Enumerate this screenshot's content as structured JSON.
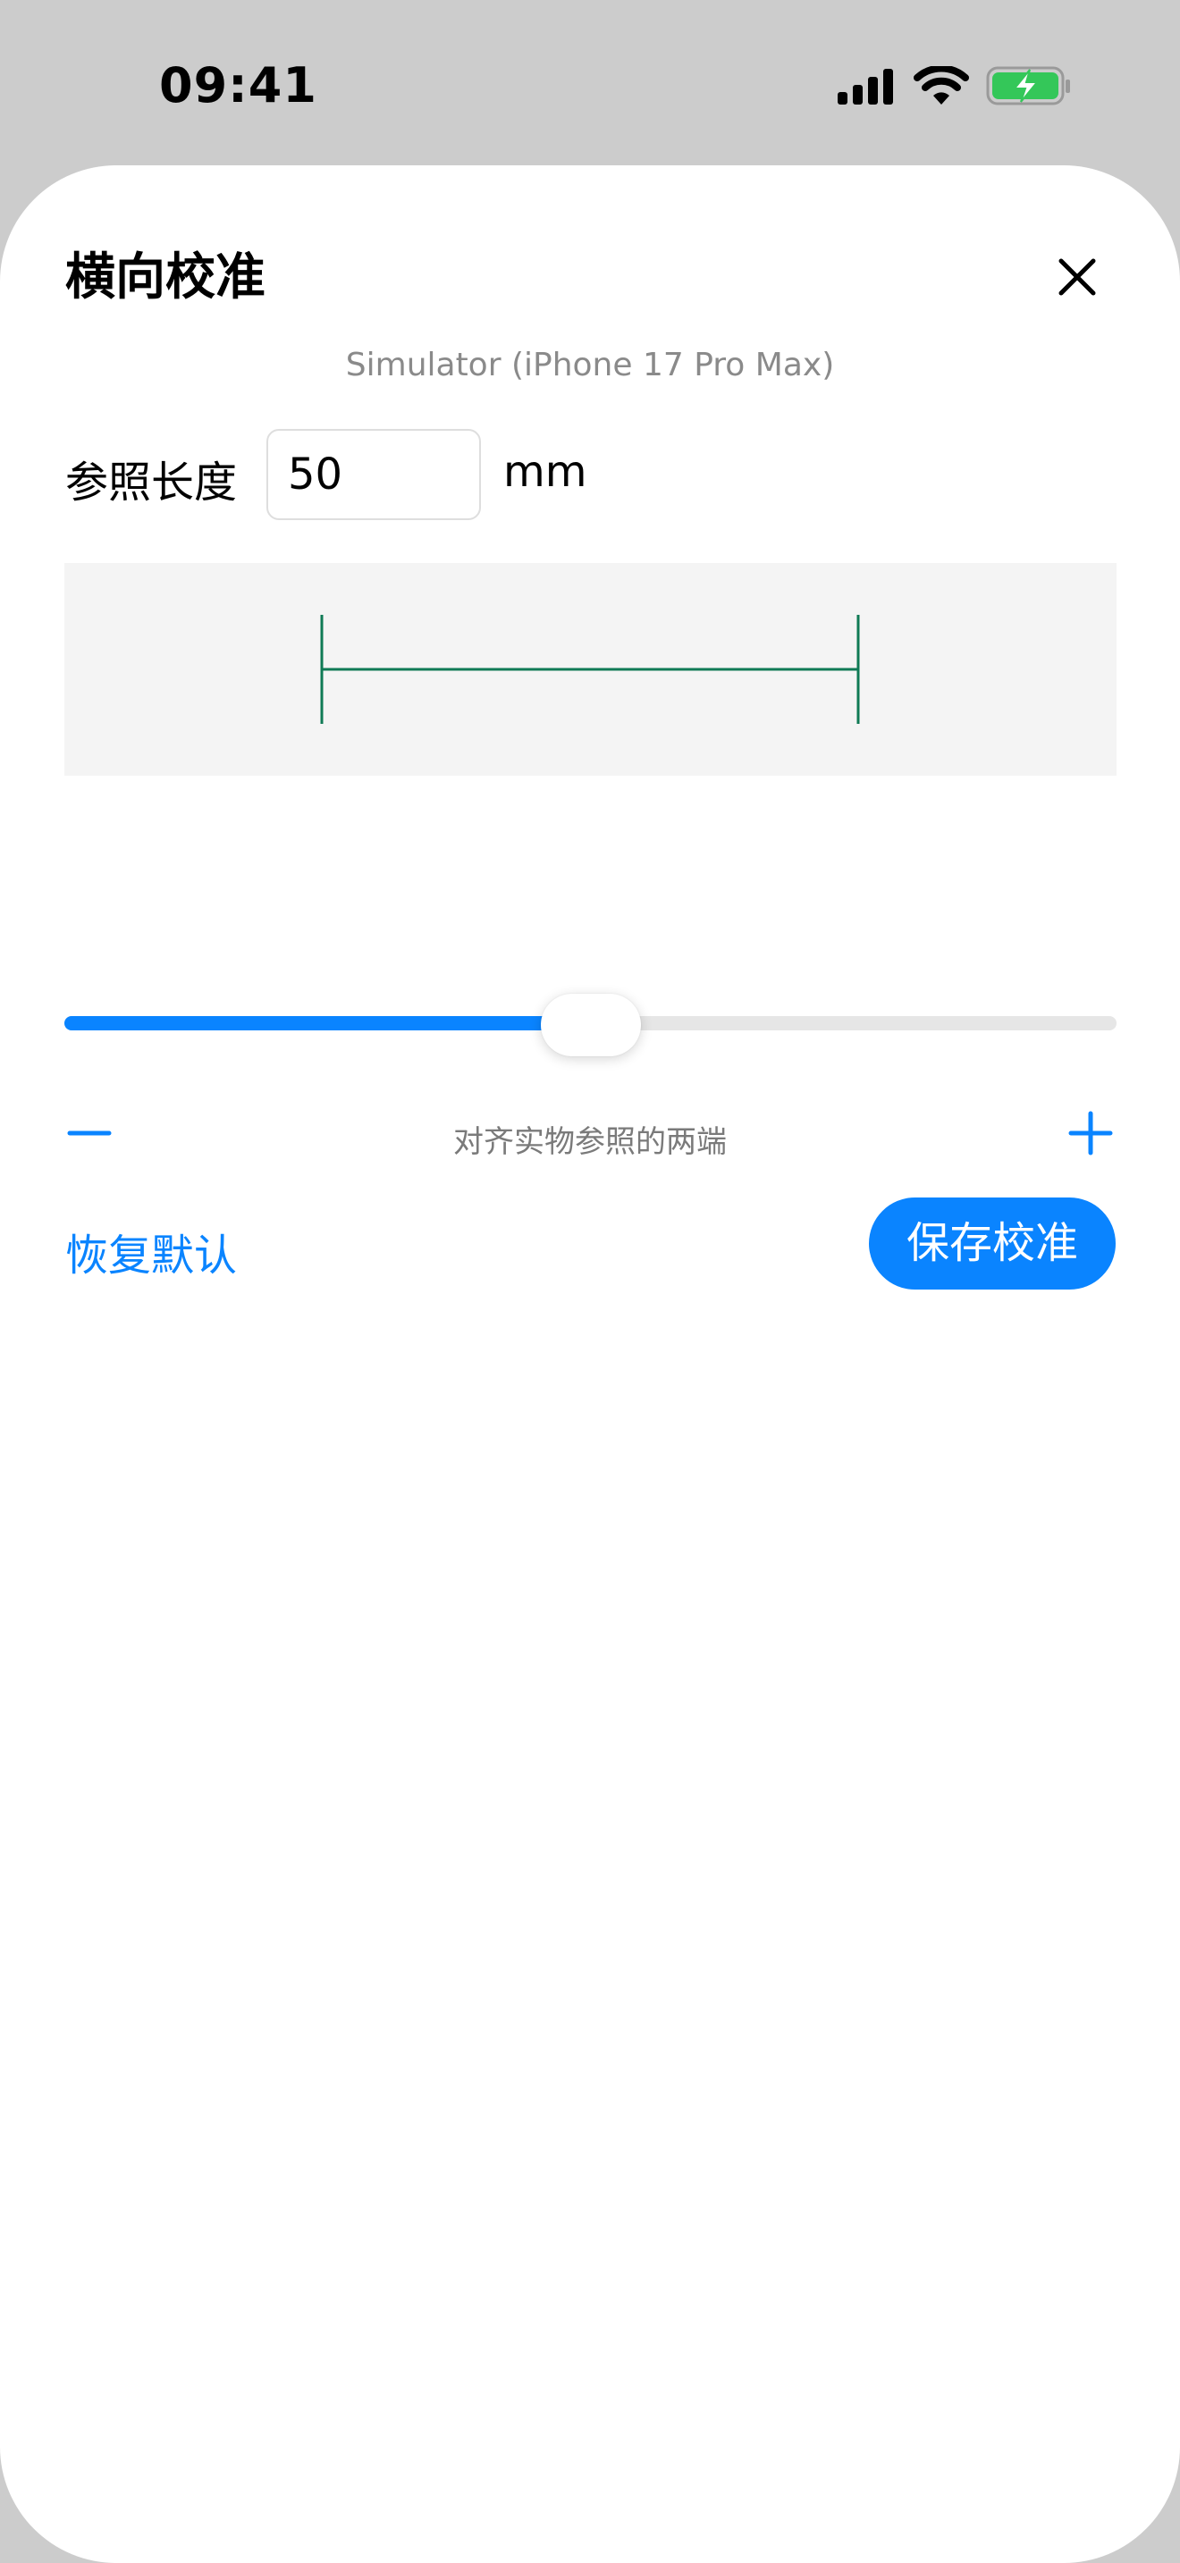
{
  "status_bar": {
    "time": "09:41"
  },
  "sheet": {
    "title": "横向校准",
    "device_name": "Simulator (iPhone 17 Pro Max)",
    "reference": {
      "label": "参照长度",
      "value": "50",
      "unit": "mm"
    },
    "slider": {
      "value_fraction": 0.5
    },
    "hint": "对齐实物参照的两端",
    "reset_label": "恢复默认",
    "save_label": "保存校准"
  },
  "colors": {
    "accent": "#0a84ff",
    "ruler_line": "#0f7a55",
    "battery": "#34c759"
  },
  "icons": {
    "close": "close-icon",
    "minus": "minus-icon",
    "plus": "plus-icon",
    "signal": "cellular-signal-icon",
    "wifi": "wifi-icon",
    "battery": "battery-charging-icon"
  }
}
